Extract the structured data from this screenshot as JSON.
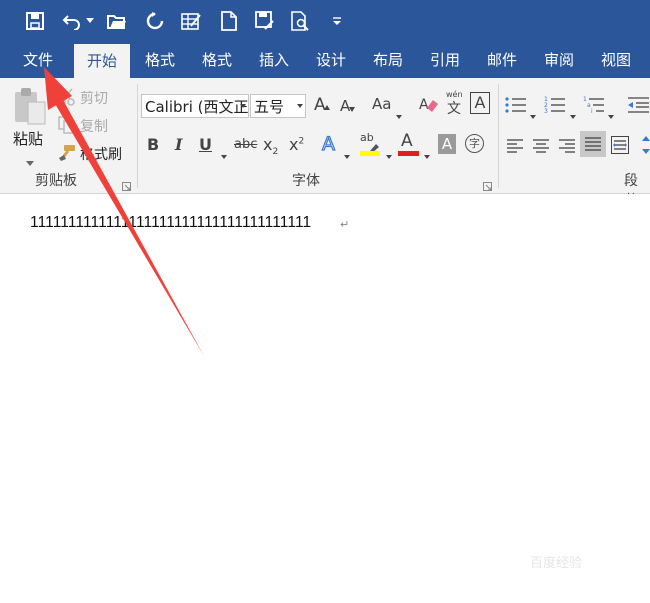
{
  "tabs": [
    "文件",
    "开始",
    "格式",
    "格式",
    "插入",
    "设计",
    "布局",
    "引用",
    "邮件",
    "审阅",
    "视图"
  ],
  "clipboard": {
    "paste_label": "粘贴",
    "cut_label": "剪切",
    "copy_label": "复制",
    "format_painter_label": "格式刷",
    "group_label": "剪贴板"
  },
  "font": {
    "font_name": "Calibri (西文正",
    "font_size": "五号",
    "grow_label": "A",
    "shrink_label": "A",
    "case_label": "Aa",
    "phonetic_top": "wén",
    "phonetic_char": "文",
    "border_char": "A",
    "bold": "B",
    "italic": "I",
    "underline": "U",
    "strike": "abc",
    "sub": "x",
    "sub_mark": "2",
    "sup": "x",
    "sup_mark": "2",
    "effects": "A",
    "highlight": "ab",
    "color": "A",
    "shade": "A",
    "enclose": "字",
    "group_label": "字体"
  },
  "paragraph": {
    "group_label": "段落"
  },
  "document": {
    "text": "1111111111111111111111111111111111111",
    "mark": "↵"
  },
  "watermark": "百度经验",
  "colors": {
    "ribbon_blue": "#2b579a",
    "arrow_red": "#f0403a",
    "font_red": "#e02020",
    "highlight_yellow": "#ffff00"
  }
}
